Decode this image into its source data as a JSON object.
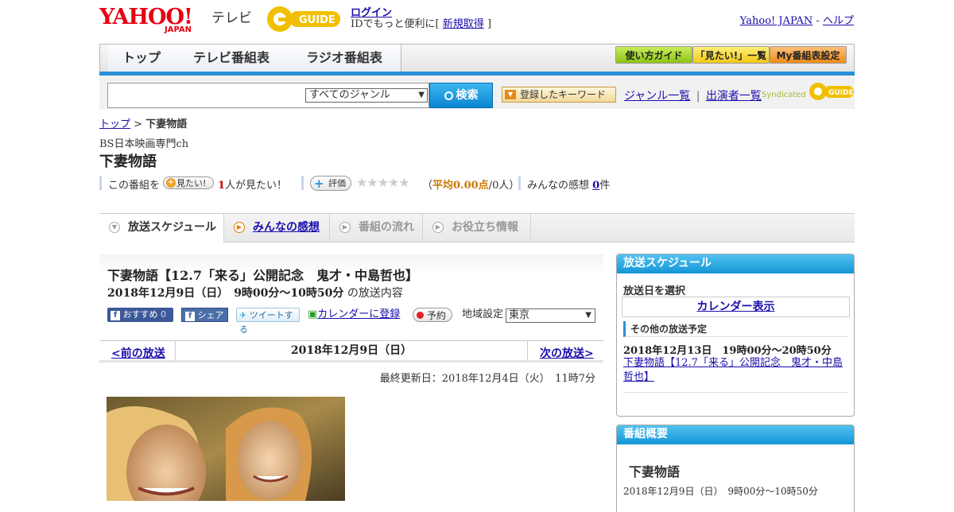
{
  "header": {
    "logo_text": "YAHOO! JAPAN",
    "tv_label": "テレビ",
    "gguide_logo": "G-GUIDE",
    "login_label": "ログイン",
    "login_note_prefix": "IDでもっと便利に[",
    "signup_label": "新規取得",
    "login_note_suffix": "]",
    "yahoo_japan_link": "Yahoo! JAPAN",
    "separator": "-",
    "help_link": "ヘルプ"
  },
  "nav": {
    "tabs": [
      "トップ",
      "テレビ番組表",
      "ラジオ番組表"
    ],
    "guide_button": "使い方ガイド",
    "wishlist_button": "「見たい!」一覧",
    "mylist_button": "My番組表設定"
  },
  "search": {
    "query": "",
    "genre_selected": "すべてのジャンル",
    "search_button": "検索",
    "keyword_button": "登録したキーワード",
    "genre_list_link": "ジャンル一覧",
    "link_separator": "|",
    "performer_list_link": "出演者一覧",
    "syndicated_label": "Syndicated"
  },
  "breadcrumb": {
    "home": "トップ",
    "sep": ">",
    "current": "下妻物語"
  },
  "program": {
    "channel": "BS日本映画専門ch",
    "title": "下妻物語",
    "want_prefix": "この番組を",
    "want_button": "見たい!",
    "want_count": "1",
    "want_suffix": "人が見たい！",
    "rating_button": "評価",
    "stars": "★★★★★",
    "avg_open": "（",
    "avg_label": "平均0.00点",
    "avg_people": "/0人）",
    "impressions_label": "みんなの感想",
    "impressions_count": "0",
    "impressions_unit": "件"
  },
  "tabs": {
    "schedule": "放送スケジュール",
    "impressions": "みんなの感想",
    "flow": "番組の流れ",
    "info": "お役立ち情報"
  },
  "broadcast": {
    "title": "下妻物語【12.7「来る」公開記念　鬼才・中島哲也】",
    "datetime": "2018年12月9日（日）　9時00分～10時50分",
    "datetime_suffix": "の放送内容",
    "recommend_label": "おすすめ",
    "recommend_count": "0",
    "share_label": "シェア",
    "tweet_label": "ツイートする",
    "calendar_label": "カレンダーに登録",
    "reserve_label": "予約",
    "region_label": "地域設定",
    "region_selected": "東京"
  },
  "pager": {
    "prev": "<前の放送",
    "current": "2018年12月9日（日）",
    "next": "次の放送>"
  },
  "updated": "最終更新日：2018年12月4日（火）　11時7分",
  "sidebar": {
    "schedule_title": "放送スケジュール",
    "select_date_label": "放送日を選択",
    "calendar_link": "カレンダー表示",
    "other_schedule_title": "その他の放送予定",
    "other_items": [
      {
        "datetime": "2018年12月13日　19時00分～20時50分",
        "title": "下妻物語【12.7「来る」公開記念　鬼才・中島哲也】"
      }
    ],
    "summary_title": "番組概要",
    "summary_program_title": "下妻物語",
    "summary_datetime": "2018年12月9日（日）　9時00分～10時50分"
  },
  "colors": {
    "link": "#1a0dab",
    "accent_blue": "#2a8fd6",
    "count_red": "#cc0000",
    "rating_orange": "#c87a00",
    "star_gray": "#cccccc"
  }
}
